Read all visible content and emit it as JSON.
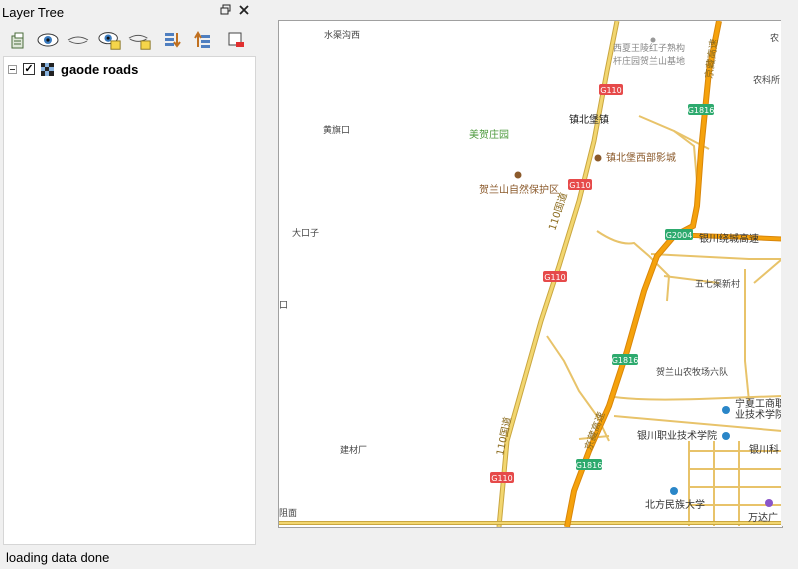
{
  "panel": {
    "title": "Layer Tree",
    "float_icon": "restore-window-icon",
    "close_icon": "close-icon"
  },
  "toolbar": {
    "buttons": [
      {
        "name": "add-group-icon"
      },
      {
        "name": "show-all-layers-icon"
      },
      {
        "name": "hide-all-layers-icon"
      },
      {
        "name": "show-selected-layers-icon"
      },
      {
        "name": "hide-selected-layers-icon"
      },
      {
        "name": "expand-all-icon"
      },
      {
        "name": "collapse-all-icon"
      },
      {
        "name": "remove-layer-icon"
      }
    ]
  },
  "layers": [
    {
      "name": "gaode roads",
      "checked": true,
      "expanded": true
    }
  ],
  "status": "loading data done",
  "map": {
    "labels": {
      "l1": "水渠沟西",
      "l2": "西夏王陵红子熟构",
      "l3": "杆庄园贺兰山基地",
      "l4": "农科所",
      "l5": "黄旗口",
      "l6": "镇北堡镇",
      "l7": "美贺庄园",
      "l8": "镇北堡西部影城",
      "l9": "贺兰山自然保护区",
      "l10": "大口子",
      "l11": "银川绕城高速",
      "l12": "五七渠新村",
      "l13": "贺兰山农牧场六队",
      "l14": "宁夏工商职",
      "l15": "业技术学院",
      "l16": "银川职业技术学院",
      "l17": "银川科",
      "l18": "建材厂",
      "l19": "北方民族大学",
      "l20": "万达广",
      "l21": "口",
      "l22": "阻面",
      "l23": "农"
    },
    "shields": {
      "s1": "G110",
      "s2": "G1816",
      "s3": "G110",
      "s4": "G2004",
      "s5": "G110",
      "s6": "G1816",
      "s7": "G1816",
      "s8": "G110"
    },
    "road_labels": {
      "r1": "110国道",
      "r2": "110国道",
      "r3": "京藏高速",
      "r4": "京藏高速"
    },
    "colors": {
      "highway": "#f5a20c",
      "highway_casing": "#d8860a",
      "major_road": "#f2d670",
      "major_road_casing": "#c9a640",
      "minor_road": "#e8c36a",
      "shield_red": "#e64a4a",
      "shield_green": "#2daa6e",
      "text_dark": "#444444",
      "text_brown": "#8b5a2b",
      "text_green": "#4d9a3c",
      "poi_blue": "#2a86c8"
    }
  }
}
